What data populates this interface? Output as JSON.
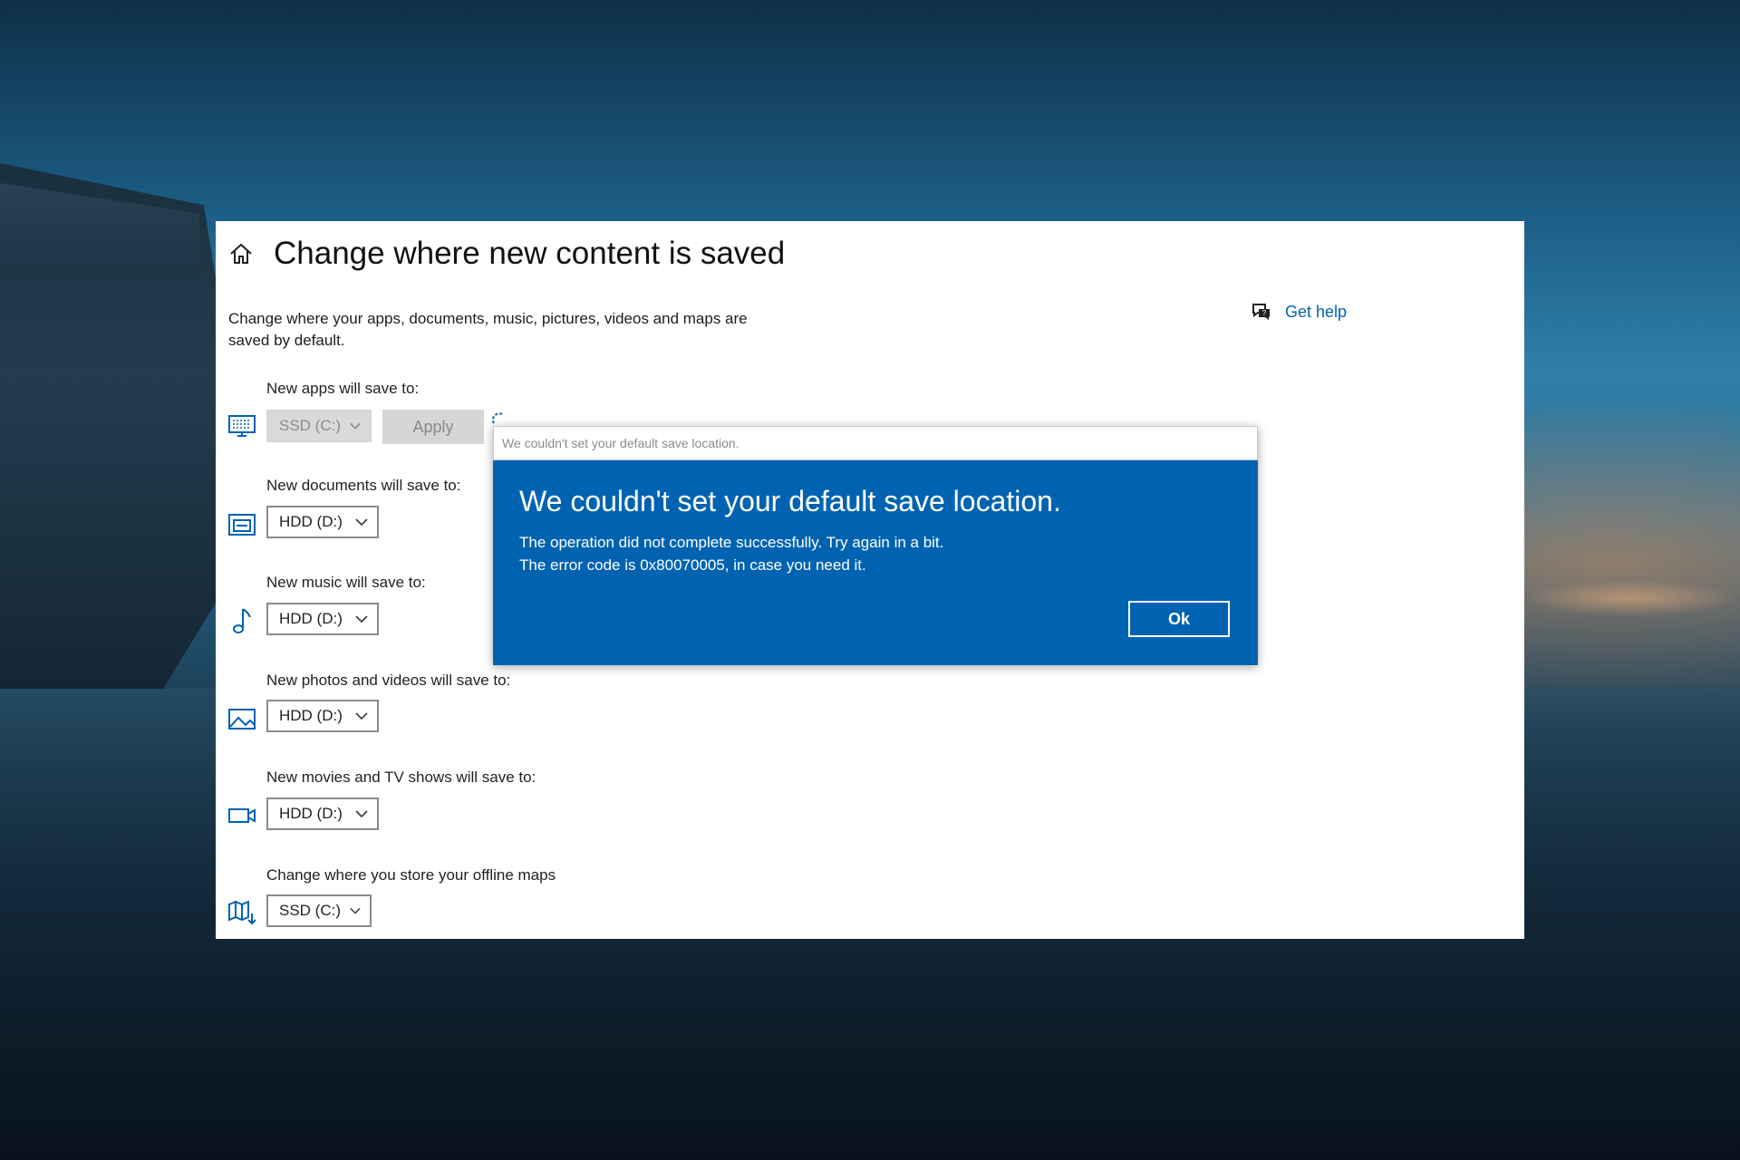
{
  "window": {
    "title": "Change where new content is saved",
    "description": "Change where your apps, documents, music, pictures, videos and maps are saved by default.",
    "get_help": "Get help",
    "icons": {
      "home": "home-icon",
      "help": "help-chat-icon"
    }
  },
  "rows": [
    {
      "label": "New apps will save to:",
      "value": "SSD (C:)",
      "icon": "monitor-icon",
      "disabled": true
    },
    {
      "label": "New documents will save to:",
      "value": "HDD (D:)",
      "icon": "documents-icon"
    },
    {
      "label": "New music will save to:",
      "value": "HDD (D:)",
      "icon": "music-note-icon"
    },
    {
      "label": "New photos and videos will save to:",
      "value": "HDD (D:)",
      "icon": "picture-icon"
    },
    {
      "label": "New movies and TV shows will save to:",
      "value": "HDD (D:)",
      "icon": "video-camera-icon"
    },
    {
      "label": "Change where you store your offline maps",
      "value": "SSD (C:)",
      "icon": "map-download-icon"
    }
  ],
  "apply_button": "Apply",
  "dialog": {
    "bar_title": "We couldn't set your default save location.",
    "title": "We couldn't set your default save location.",
    "message_line1": "The operation did not complete successfully. Try again in a bit.",
    "message_line2": "The error code is 0x80070005, in case you need it.",
    "ok_label": "Ok"
  },
  "colors": {
    "accent": "#0063b1",
    "window_bg": "#ffffff",
    "disabled_bg": "#d9d9d9"
  }
}
